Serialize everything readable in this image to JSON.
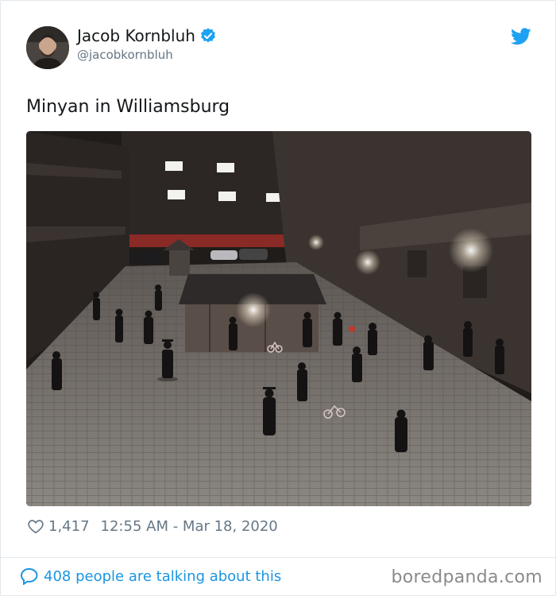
{
  "author": {
    "name": "Jacob Kornbluh",
    "handle": "@jacobkornbluh",
    "verified": true,
    "avatar_icon": "profile-photo"
  },
  "tweet": {
    "text": "Minyan in Williamsburg",
    "media_icon": "photo-courtyard-night"
  },
  "meta": {
    "likes": "1,417",
    "time_date": "12:55 AM - Mar 18, 2020"
  },
  "footer": {
    "talking": "408 people are talking about this",
    "watermark": "boredpanda.com"
  },
  "colors": {
    "accent": "#1b95e0",
    "muted": "#657786",
    "text": "#14171a",
    "border": "#e1e8ed"
  }
}
